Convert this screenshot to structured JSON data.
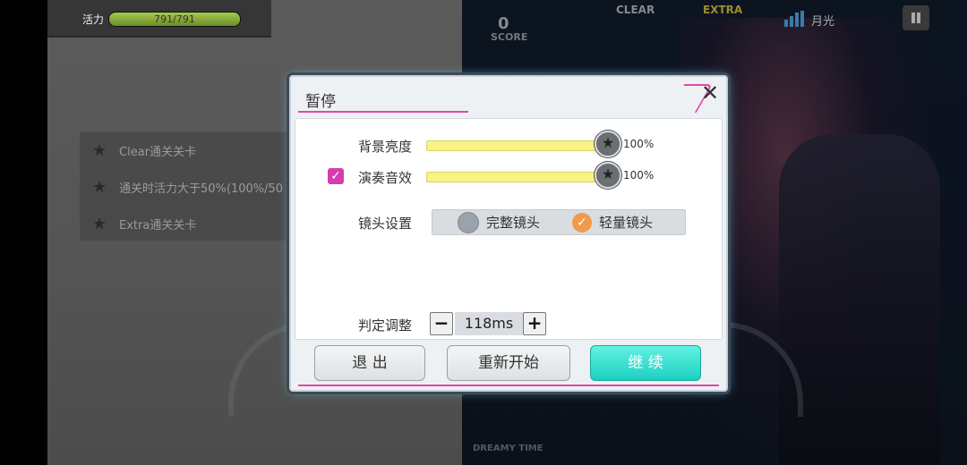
{
  "hud": {
    "hp_label": "活力",
    "hp_text": "791/791",
    "hp_fraction": 1.0,
    "score_value": "0",
    "score_label": "SCORE",
    "clear_label": "CLEAR",
    "extra_label": "EXTRA",
    "song_title": "月光",
    "signal_icon": "signal-bars-icon",
    "pause_icon": "pause-icon",
    "footer_logo": "DREAMY TIME"
  },
  "missions": [
    {
      "icon": "star-icon",
      "text": "Clear通关关卡"
    },
    {
      "icon": "star-icon",
      "text": "通关时活力大于50%(100%/50"
    },
    {
      "icon": "star-icon",
      "text": "Extra通关关卡"
    }
  ],
  "dialog": {
    "title": "暂停",
    "close_icon": "close-icon",
    "bg_brightness": {
      "label": "背景亮度",
      "value": "100%",
      "level": 1.0
    },
    "sound_effect": {
      "label": "演奏音效",
      "value": "100%",
      "level": 1.0,
      "checked": true
    },
    "camera": {
      "label": "镜头设置",
      "options": [
        {
          "label": "完整镜头",
          "selected": false
        },
        {
          "label": "轻量镜头",
          "selected": true
        }
      ]
    },
    "judgement": {
      "label": "判定调整",
      "minus": "−",
      "plus": "+",
      "value": "118ms"
    },
    "buttons": {
      "exit": "退 出",
      "restart": "重新开始",
      "continue": "继 续"
    }
  },
  "colors": {
    "accent_pink": "#e04aa8",
    "continue_teal": "#1ed0c2",
    "slider_yellow": "#f9f47f",
    "radio_orange": "#f29a4a"
  }
}
